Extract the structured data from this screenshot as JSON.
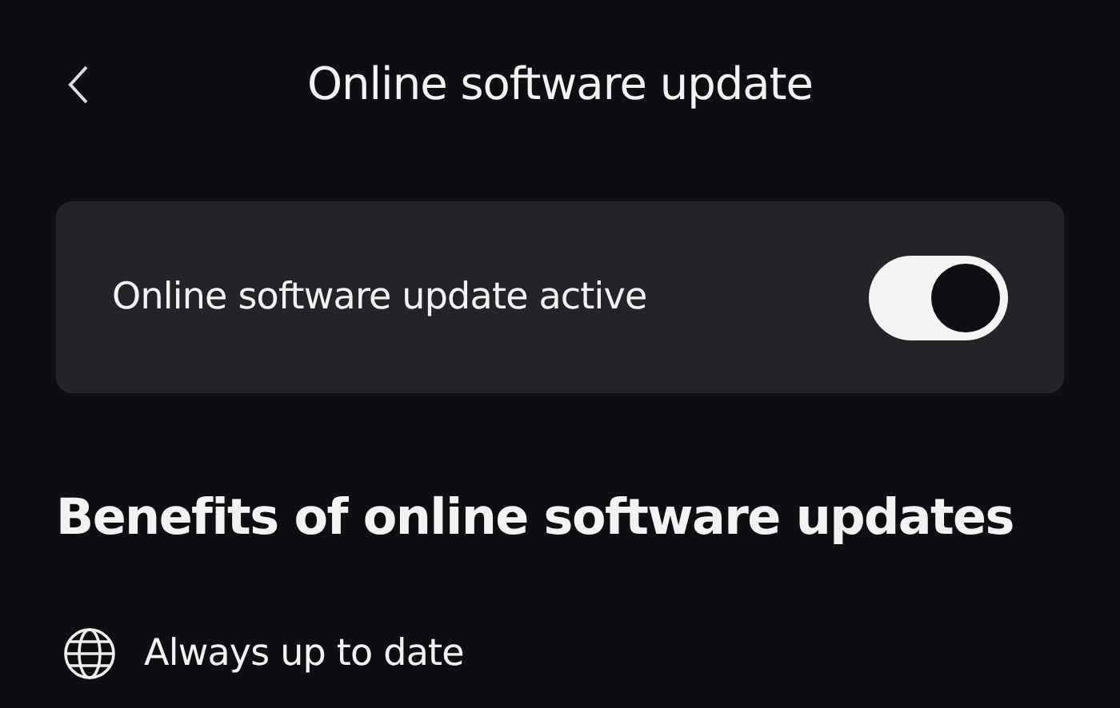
{
  "header": {
    "title": "Online software update"
  },
  "setting": {
    "label": "Online software update active",
    "on": true
  },
  "benefits": {
    "heading": "Benefits of online software updates",
    "items": [
      {
        "label": "Always up to date"
      }
    ]
  }
}
